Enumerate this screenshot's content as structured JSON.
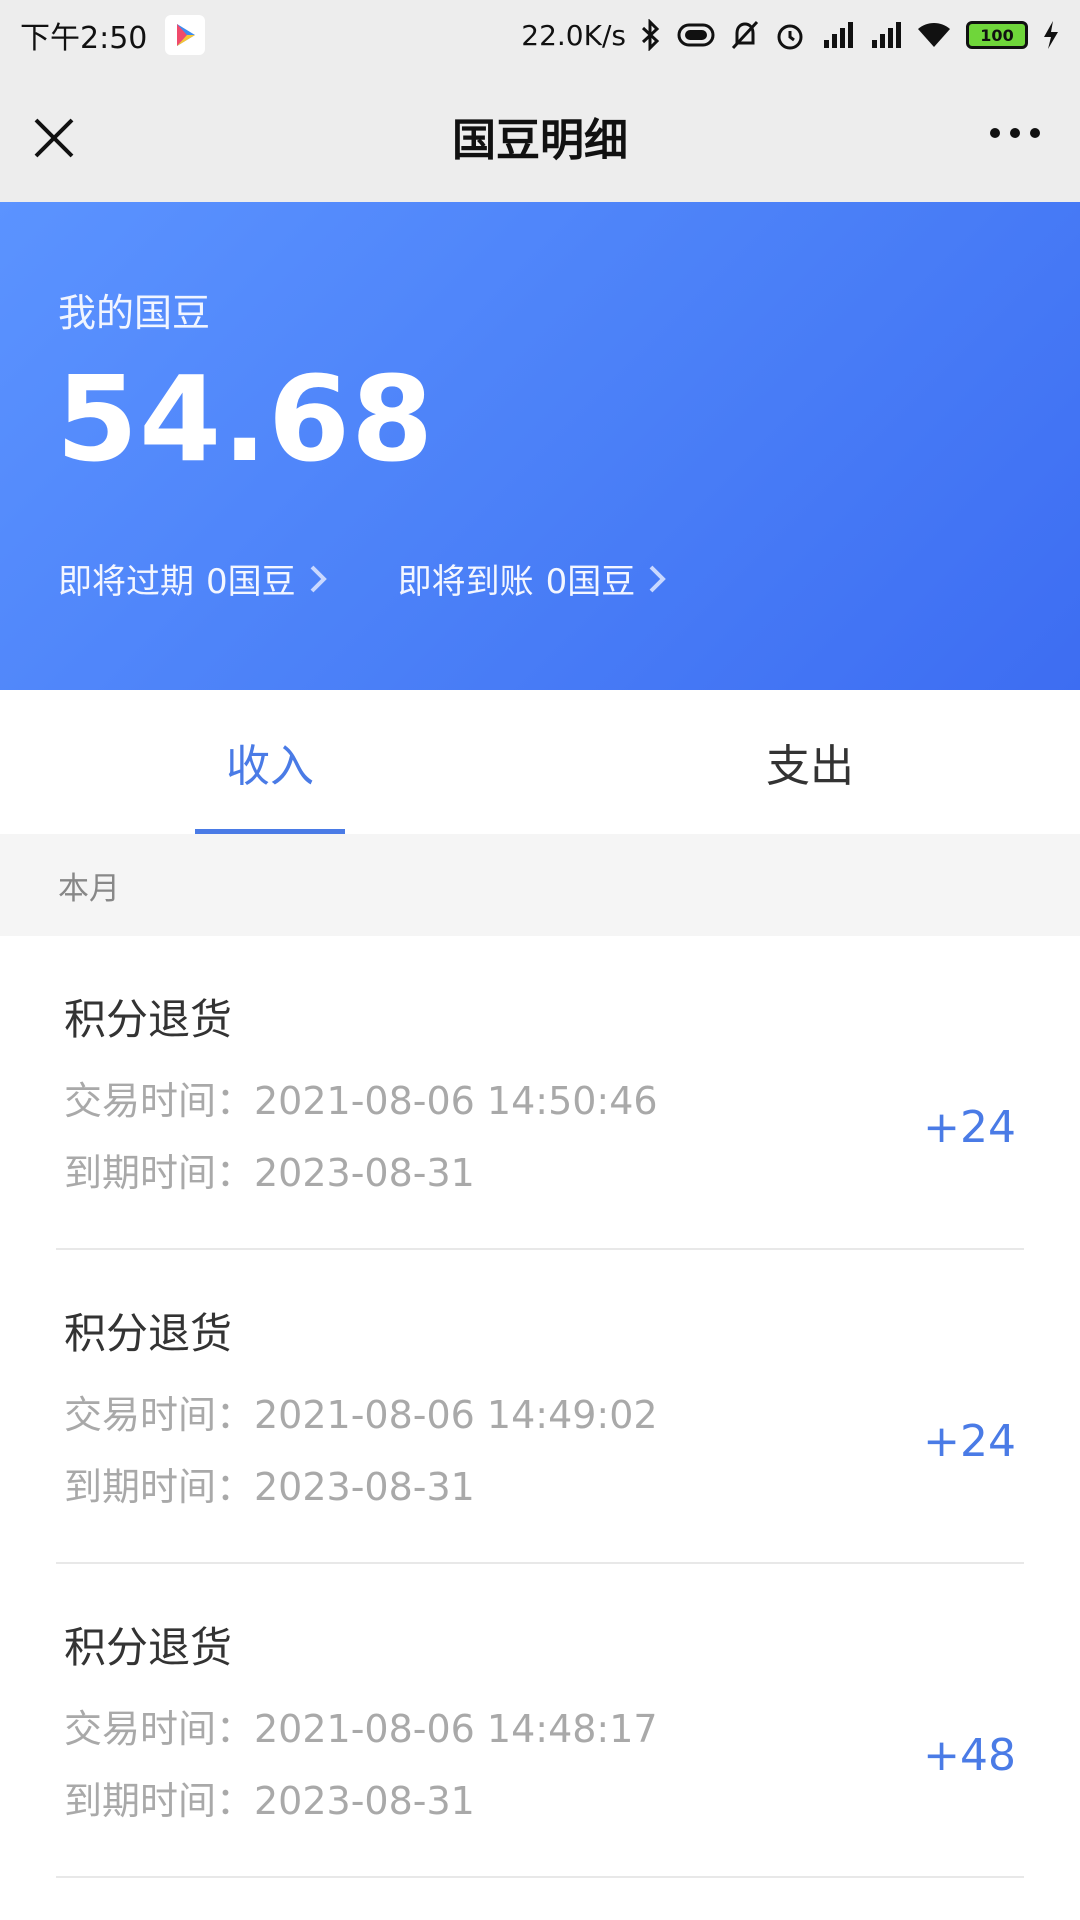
{
  "status_bar": {
    "time": "下午2:50",
    "net_speed": "22.0K/s",
    "battery": "100"
  },
  "nav": {
    "title": "国豆明细"
  },
  "hero": {
    "label": "我的国豆",
    "amount": "54.68",
    "expiring_label": "即将过期",
    "expiring_value": "0国豆",
    "arriving_label": "即将到账",
    "arriving_value": "0国豆"
  },
  "tabs": [
    {
      "label": "收入",
      "active": true
    },
    {
      "label": "支出",
      "active": false
    }
  ],
  "section": {
    "label": "本月"
  },
  "records": [
    {
      "title": "积分退货",
      "trade_time": "交易时间：2021-08-06 14:50:46",
      "expire_time": "到期时间：2023-08-31",
      "amount": "+24"
    },
    {
      "title": "积分退货",
      "trade_time": "交易时间：2021-08-06 14:49:02",
      "expire_time": "到期时间：2023-08-31",
      "amount": "+24"
    },
    {
      "title": "积分退货",
      "trade_time": "交易时间：2021-08-06 14:48:17",
      "expire_time": "到期时间：2023-08-31",
      "amount": "+48"
    }
  ],
  "colors": {
    "accent": "#4a7be6",
    "hero_start": "#5b93ff",
    "hero_end": "#3d6df2"
  }
}
